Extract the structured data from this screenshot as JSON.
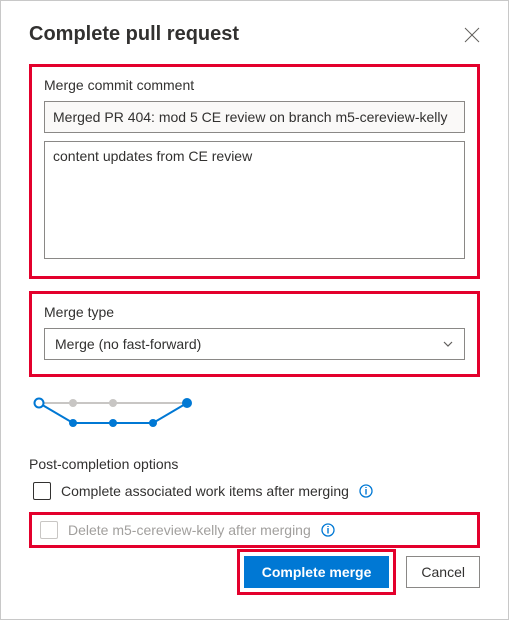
{
  "dialog": {
    "title": "Complete pull request"
  },
  "commit_section": {
    "label": "Merge commit comment",
    "title_value": "Merged PR 404: mod 5 CE review on branch m5-cereview-kelly",
    "description_value": "content updates from CE review"
  },
  "merge_type": {
    "label": "Merge type",
    "selected": "Merge (no fast-forward)"
  },
  "post_completion": {
    "label": "Post-completion options",
    "option1": {
      "label": "Complete associated work items after merging",
      "checked": false,
      "disabled": false
    },
    "option2": {
      "label": "Delete m5-cereview-kelly after merging",
      "checked": false,
      "disabled": true
    }
  },
  "footer": {
    "complete_label": "Complete merge",
    "cancel_label": "Cancel"
  }
}
